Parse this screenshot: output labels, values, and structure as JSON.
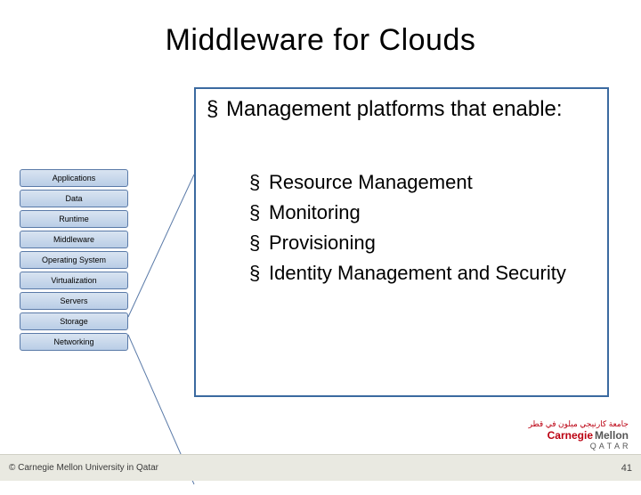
{
  "title": "Middleware for Clouds",
  "lead_bullet": "Management platforms that enable:",
  "sub_bullets": [
    "Resource Management",
    "Monitoring",
    "Provisioning",
    "Identity Management and Security"
  ],
  "stack_layers": [
    "Applications",
    "Data",
    "Runtime",
    "Middleware",
    "Operating System",
    "Virtualization",
    "Servers",
    "Storage",
    "Networking"
  ],
  "highlight_index": 3,
  "footer": {
    "copyright": "© Carnegie Mellon University in Qatar",
    "page": "41"
  },
  "logo": {
    "arabic": "جامعة كارنيجي ميلون في قطر",
    "line1a": "Carnegie",
    "line1b": "Mellon",
    "line2": "Q A T A R"
  },
  "bullet_marker": "§"
}
